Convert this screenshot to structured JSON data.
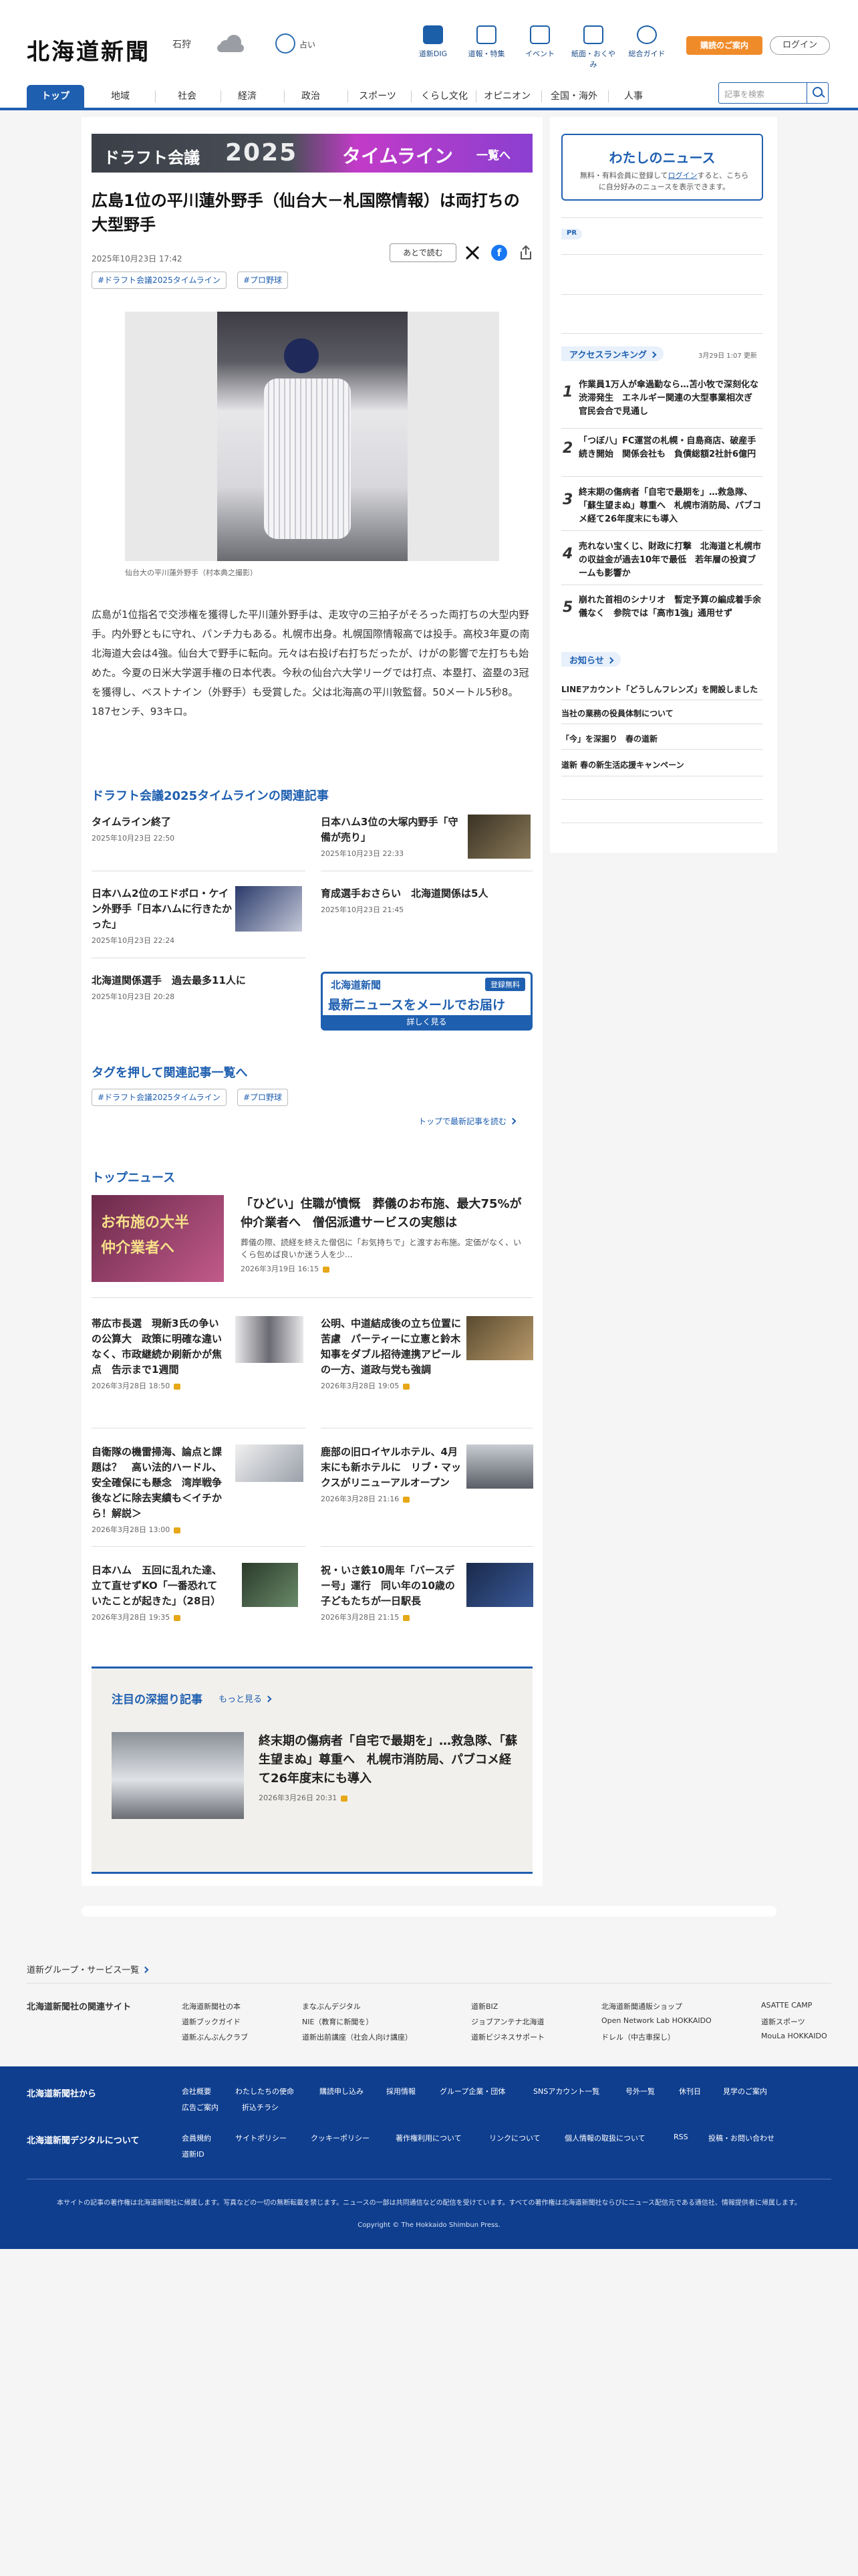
{
  "header": {
    "logo": "北海道新聞",
    "weather_city": "石狩",
    "location_label": "占い",
    "nav": [
      {
        "label": "道新DIG",
        "icon": "book-icon"
      },
      {
        "label": "道報・特集",
        "icon": "flag-icon"
      },
      {
        "label": "イベント",
        "icon": "calendar-icon"
      },
      {
        "label": "紙面・おくやみ",
        "icon": "newspaper-icon"
      },
      {
        "label": "総合ガイド",
        "icon": "help-icon"
      }
    ],
    "subscribe_label": "購読のご案内",
    "login_label": "ログイン"
  },
  "global_nav": {
    "items": [
      "トップ",
      "地域",
      "社会",
      "経済",
      "政治",
      "スポーツ",
      "くらし文化",
      "オピニオン",
      "全国・海外",
      "人事"
    ],
    "active": "トップ",
    "search_placeholder": "記事を検索"
  },
  "banner": {
    "left": "ドラフト会議",
    "year": "2025",
    "right": "タイムライン",
    "more": "一覧へ"
  },
  "article": {
    "title": "広島1位の平川蓮外野手（仙台大－札国際情報）は両打ちの大型野手",
    "date": "2025年10月23日 17:42",
    "read_later": "あとで読む",
    "tags": [
      "#ドラフト会議2025タイムライン",
      "#プロ野球"
    ],
    "photo_caption": "仙台大の平川蓮外野手（村本典之撮影）",
    "body": "広島が1位指名で交渉権を獲得した平川蓮外野手は、走攻守の三拍子がそろった両打ちの大型内野手。内外野ともに守れ、パンチ力もある。札幌市出身。札幌国際情報高では投手。高校3年夏の南北海道大会は4強。仙台大で野手に転向。元々は右投げ右打ちだったが、けがの影響で左打ちも始めた。今夏の日米大学選手権の日本代表。今秋の仙台六大学リーグでは打点、本塁打、盗塁の3冠を獲得し、ベストナイン（外野手）も受賞した。父は北海高の平川敦監督。50メートル5秒8。187センチ、93キロ。"
  },
  "related": {
    "heading": "ドラフト会議2025タイムラインの関連記事",
    "items": [
      {
        "title": "タイムライン終了",
        "date": "2025年10月23日 22:50"
      },
      {
        "title": "日本ハム3位の大塚内野手「守備が売り」",
        "date": "2025年10月23日 22:33"
      },
      {
        "title": "日本ハム2位のエドポロ・ケイン外野手「日本ハムに行きたかった」",
        "date": "2025年10月23日 22:24"
      },
      {
        "title": "育成選手おさらい　北海道関係は5人",
        "date": "2025年10月23日 21:45"
      },
      {
        "title": "北海道関係選手　過去最多11人に",
        "date": "2025年10月23日 20:28"
      }
    ],
    "mail_ad": {
      "logo": "北海道新聞",
      "free": "登録無料",
      "main": "最新ニュースをメールでお届け",
      "sub": "詳しく見る"
    }
  },
  "tag_section": {
    "heading": "タグを押して関連記事一覧へ",
    "tags": [
      "#ドラフト会議2025タイムライン",
      "#プロ野球"
    ],
    "top_link": "トップで最新記事を読む"
  },
  "top_news": {
    "heading": "トップニュース",
    "lead": {
      "title": "「ひどい」住職が憤慨　葬儀のお布施、最大75%が仲介業者へ　僧侶派遣サービスの実態は",
      "summary": "葬儀の際、読経を終えた僧侶に「お気持ちで」と渡すお布施。定価がなく、いくら包めば良いか迷う人を少...",
      "date": "2026年3月19日 16:15",
      "thumb_text": "お布施の大半\n仲介業者へ"
    },
    "items": [
      {
        "title": "帯広市長選　現新3氏の争いの公算大　政策に明確な違いなく、市政継続か刷新かが焦点　告示まで1週間",
        "date": "2026年3月28日 18:50"
      },
      {
        "title": "公明、中道結成後の立ち位置に苦慮　パーティーに立憲と鈴木知事をダブル招待連携アピールの一方、道政与党も強調",
        "date": "2026年3月28日 19:05"
      },
      {
        "title": "自衛隊の機雷掃海、論点と課題は？　高い法的ハードル、安全確保にも懸念　湾岸戦争後などに除去実績も＜イチから！解説＞",
        "date": "2026年3月28日 13:00"
      },
      {
        "title": "鹿部の旧ロイヤルホテル、4月末にも新ホテルに　リブ・マックスがリニューアルオープン",
        "date": "2026年3月28日 21:16"
      },
      {
        "title": "日本ハム　五回に乱れた達、立て直せずKO「一番恐れていたことが起きた」（28日）",
        "date": "2026年3月28日 19:35"
      },
      {
        "title": "祝・いさ鉄10周年「バースデー号」運行　同い年の10歳の子どもたちが一日駅長",
        "date": "2026年3月28日 21:15"
      }
    ]
  },
  "deep_dive": {
    "heading": "注目の深掘り記事",
    "more": "もっと見る",
    "title": "終末期の傷病者「自宅で最期を」…救急隊、「蘇生望まぬ」尊重へ　札幌市消防局、パブコメ経て26年度末にも導入",
    "date": "2026年3月26日 20:31"
  },
  "sidebar": {
    "my_news": {
      "heading": "わたしのニュース",
      "desc": "無料・有料会員に登録して",
      "login": "ログイン",
      "desc2": "すると、こちらに自分好みのニュースを表示できます。"
    },
    "pr_label": "PR",
    "ranking": {
      "heading": "アクセスランキング",
      "updated": "3月29日 1:07 更新",
      "items": [
        {
          "rank": "1",
          "title": "作業員1万人が傘過勤なら…苫小牧で深刻化な渋滞発生　エネルギー関連の大型事業相次ぎ　官民会合で見通し"
        },
        {
          "rank": "2",
          "title": "「つぼ八」FC運営の札幌・自島商店、破産手続き開始　関係会社も　負債総額2社計6億円"
        },
        {
          "rank": "3",
          "title": "終末期の傷病者「自宅で最期を」…救急隊、「蘇生望まぬ」尊重へ　札幌市消防局、パブコメ経て26年度末にも導入"
        },
        {
          "rank": "4",
          "title": "売れない宝くじ、財政に打撃　北海道と札幌市の収益金が過去10年で最低　若年層の投資ブームも影響か"
        },
        {
          "rank": "5",
          "title": "崩れた首相のシナリオ　暫定予算の編成着手余儀なく　参院では「高市1強」通用せず"
        }
      ]
    },
    "notices": {
      "heading": "お知らせ",
      "items": [
        "LINEアカウント「どうしんフレンズ」を開設しました",
        "当社の業務の役員体制について",
        "「今」を深掘り　春の道新",
        "道新 春の新生活応援キャンペーン"
      ]
    }
  },
  "footer": {
    "group_link": "道新グループ・サービス一覧",
    "related_heading": "北海道新聞社の関連サイト",
    "related_links": [
      "北海道新聞社の本",
      "まなぶんデジタル",
      "道新BIZ",
      "北海道新聞通販ショップ",
      "ASATTE CAMP",
      "道新ブックガイド",
      "NIE（教育に新聞を）",
      "ジョブアンテナ北海道",
      "Open Network Lab HOKKAIDO",
      "道新スポーツ",
      "道新ぶんぶんクラブ",
      "道新出前講座（社会人向け講座）",
      "道新ビジネスサポート",
      "ドレル（中古車探し）",
      "MouLa HOKKAIDO"
    ],
    "from_heading": "北海道新聞社から",
    "from_links": [
      "会社概要",
      "わたしたちの使命",
      "購読申し込み",
      "採用情報",
      "グループ企業・団体",
      "SNSアカウント一覧",
      "号外一覧",
      "休刊日",
      "見学のご案内",
      "広告ご案内",
      "折込チラシ"
    ],
    "digital_heading": "北海道新聞デジタルについて",
    "digital_links": [
      "会員規約",
      "サイトポリシー",
      "クッキーポリシー",
      "著作権利用について",
      "リンクについて",
      "個人情報の取扱について",
      "RSS",
      "投稿・お問い合わせ",
      "道新ID"
    ],
    "note": "本サイトの記事の著作権は北海道新聞社に帰属します。写真などの一切の無断転載を禁じます。ニュースの一部は共同通信などの配信を受けています。すべての著作権は北海道新聞社ならびにニュース配信元である通信社、情報提供者に帰属します。",
    "copyright": "Copyright © The Hokkaido Shimbun Press."
  }
}
